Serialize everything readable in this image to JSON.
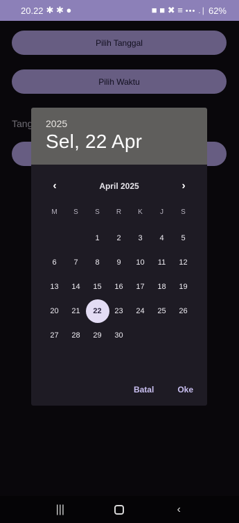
{
  "status": {
    "time": "20.22",
    "left_icons": "✱ ✱ ●",
    "right_icons": "■ ■ ✖ ≡",
    "signal": "••• .∣",
    "battery": "62%"
  },
  "app": {
    "pick_date_label": "Pilih Tanggal",
    "pick_time_label": "Pilih Waktu",
    "partial_label": "Tang"
  },
  "dialog": {
    "year": "2025",
    "selected_date": "Sel, 22 Apr",
    "month_label": "April 2025",
    "weekdays": [
      "M",
      "S",
      "S",
      "R",
      "K",
      "J",
      "S"
    ],
    "leading_blanks": 2,
    "days_in_month": 30,
    "selected_day": 22,
    "cancel_label": "Batal",
    "ok_label": "Oke"
  },
  "colors": {
    "accent": "#9e90c8",
    "status_bar": "#8c80b8",
    "selected_circle": "#e3dcf4",
    "dialog_bg": "#1e1b24",
    "header_bg": "#5f5e5c"
  }
}
